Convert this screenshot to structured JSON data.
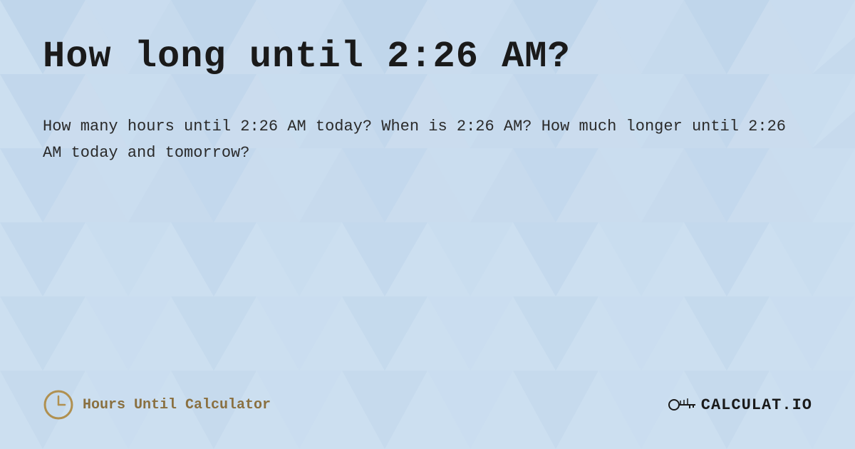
{
  "page": {
    "title": "How long until 2:26 AM?",
    "description": "How many hours until 2:26 AM today? When is 2:26 AM? How much longer until 2:26 AM today and tomorrow?",
    "background_color": "#cce0f0",
    "triangle_color_light": "#bdd5ec",
    "triangle_color_medium": "#a8c8e8"
  },
  "footer": {
    "brand_name": "Hours Until Calculator",
    "logo_text": "CALCULAT.IO",
    "clock_icon": "clock-icon",
    "hand_icon": "✌"
  }
}
